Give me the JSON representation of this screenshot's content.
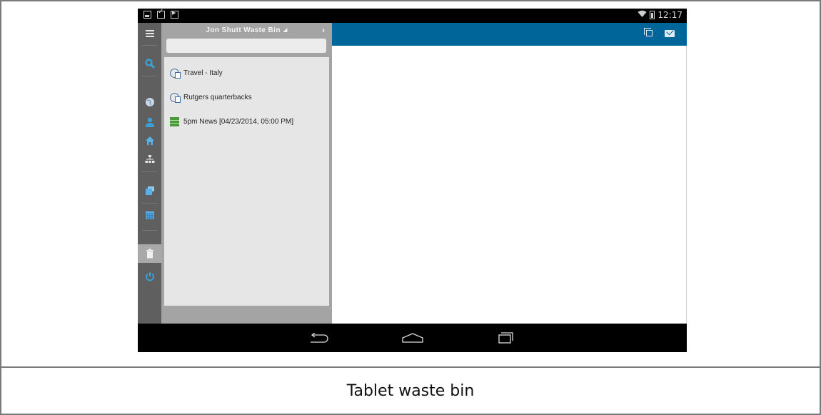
{
  "caption": "Tablet waste bin",
  "status_bar": {
    "time": "12:17",
    "notification_icons": [
      "image-icon",
      "clipboard-check-icon",
      "play-store-icon"
    ],
    "system_icons": [
      "wifi-icon",
      "battery-icon"
    ]
  },
  "rail": {
    "items": [
      {
        "name": "menu-icon"
      },
      {
        "name": "search-icon",
        "color": "#3aa0d8"
      },
      {
        "name": "globe-icon",
        "color": "#c8d8e8"
      },
      {
        "name": "person-icon",
        "color": "#3aa0d8"
      },
      {
        "name": "home-icon",
        "color": "#5ab0e8"
      },
      {
        "name": "hierarchy-icon",
        "color": "#e8e8e8"
      },
      {
        "name": "stack-icon",
        "color": "#5ab0e8"
      },
      {
        "name": "calendar-icon",
        "color": "#5ab0e8"
      },
      {
        "name": "trash-icon",
        "color": "#f0f0f0",
        "active": true
      },
      {
        "name": "power-icon",
        "color": "#3aa0d8"
      }
    ]
  },
  "panel": {
    "title": "Jon Shutt Waste Bin",
    "search": {
      "value": "",
      "placeholder": ""
    },
    "items": [
      {
        "label": "Travel - Italy",
        "icon": "saved-search-icon"
      },
      {
        "label": "Rutgers quarterbacks",
        "icon": "saved-search-icon"
      },
      {
        "label": "5pm News [04/23/2014, 05:00 PM]",
        "icon": "news-rundown-icon"
      }
    ]
  },
  "main": {
    "toolbar_icons": [
      "copy-icon",
      "mail-icon"
    ],
    "accent": "#006699"
  },
  "nav": {
    "buttons": [
      "back-icon",
      "home-icon",
      "recents-icon"
    ]
  }
}
